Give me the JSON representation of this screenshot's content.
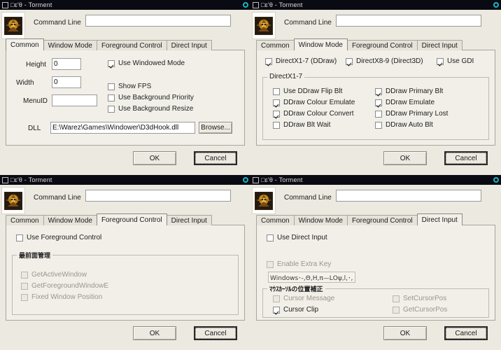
{
  "window": {
    "title": "□ɛ'θ - Torment",
    "sysmenu_icon": "system-menu-icon",
    "close_icon": "close-circle-icon",
    "app_icon": "torment-app-icon"
  },
  "header": {
    "command_line_label": "Command Line",
    "command_line_value": "",
    "command_line_placeholder": ""
  },
  "tabs": [
    {
      "label": "Common"
    },
    {
      "label": "Window Mode"
    },
    {
      "label": "Foreground Control"
    },
    {
      "label": "Direct Input"
    }
  ],
  "buttons": {
    "ok": "OK",
    "cancel": "Cancel",
    "browse": "Browse..."
  },
  "panels": {
    "common": {
      "active_tab": 0,
      "fields": [
        {
          "label": "Height",
          "value": "0"
        },
        {
          "label": "Width",
          "value": "0"
        },
        {
          "label": "MenuID",
          "value": ""
        }
      ],
      "dll_label": "DLL",
      "dll_value": "E:\\Warez\\Games\\Windower\\D3dHook.dll",
      "checkboxes": [
        {
          "label": "Use Windowed Mode",
          "checked": true,
          "disabled": false
        },
        {
          "label": "Show FPS",
          "checked": false,
          "disabled": false
        },
        {
          "label": "Use Background Priority",
          "checked": false,
          "disabled": false
        },
        {
          "label": "Use Background Resize",
          "checked": false,
          "disabled": false
        }
      ]
    },
    "window_mode": {
      "active_tab": 1,
      "top_checkboxes": [
        {
          "label": "DirectX1-7 (DDraw)",
          "checked": true
        },
        {
          "label": "DirectX8-9 (Direct3D)",
          "checked": true
        },
        {
          "label": "Use GDI",
          "checked": true
        }
      ],
      "group_title": "DirectX1-7",
      "group_checkboxes_left": [
        {
          "label": "Use DDraw Flip Blt",
          "checked": false
        },
        {
          "label": "DDraw Colour Emulate",
          "checked": true
        },
        {
          "label": "DDraw Colour Convert",
          "checked": true
        },
        {
          "label": "DDraw Blt Wait",
          "checked": false
        }
      ],
      "group_checkboxes_right": [
        {
          "label": "DDraw Primary Blt",
          "checked": true
        },
        {
          "label": "DDraw Emulate",
          "checked": true
        },
        {
          "label": "DDraw Primary Lost",
          "checked": false
        },
        {
          "label": "DDraw Auto Blt",
          "checked": false
        }
      ]
    },
    "foreground_control": {
      "active_tab": 2,
      "use_checkbox": {
        "label": "Use Foreground Control",
        "checked": false,
        "disabled": false
      },
      "group_title": "最前面管理",
      "group_checkboxes": [
        {
          "label": "GetActiveWindow",
          "checked": false,
          "disabled": true
        },
        {
          "label": "GetForegroundWindowE",
          "checked": false,
          "disabled": true
        },
        {
          "label": "Fixed Window Position",
          "checked": false,
          "disabled": true
        }
      ]
    },
    "direct_input": {
      "active_tab": 3,
      "use_checkbox": {
        "label": "Use Direct Input",
        "checked": false,
        "disabled": false
      },
      "extra_key_checkbox": {
        "label": "Enable Extra Key",
        "checked": false,
        "disabled": true
      },
      "extra_key_value": "Windows･-,Θ,H,π—LΟψ,l,･,ı",
      "group_title": "ﾏｳｽｶｰｿﾙの位置補正",
      "group_checkboxes_left": [
        {
          "label": "Cursor Message",
          "checked": false,
          "disabled": true
        },
        {
          "label": "Cursor Clip",
          "checked": true,
          "disabled": false
        }
      ],
      "group_checkboxes_right": [
        {
          "label": "SetCursorPos",
          "checked": false,
          "disabled": true
        },
        {
          "label": "GetCursorPos",
          "checked": false,
          "disabled": true
        }
      ]
    }
  },
  "colors": {
    "titlebar": "#0a0a12",
    "face": "#ece9e0",
    "tab_body": "#f1efe8",
    "accent": "#14b8c8"
  }
}
